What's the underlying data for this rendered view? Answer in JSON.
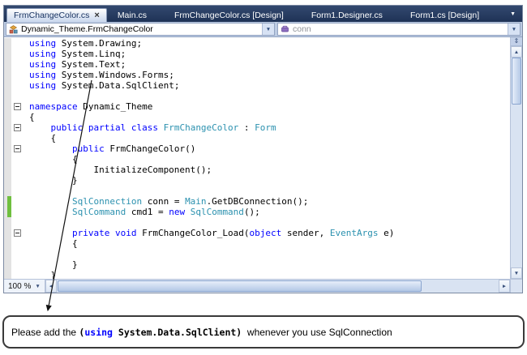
{
  "icons": {
    "close": "×",
    "dropdown": "▼",
    "up_arrow": "▲",
    "down_arrow": "▼",
    "left_arrow": "◄",
    "right_arrow": "►",
    "splitter": "⇕",
    "collapse_minus": "css-line-shape"
  },
  "window": {
    "tabs": [
      {
        "label": "FrmChangeColor.cs",
        "active": true
      },
      {
        "label": "Main.cs",
        "active": false
      },
      {
        "label": "FrmChangeColor.cs [Design]",
        "active": false
      },
      {
        "label": "Form1.Designer.cs",
        "active": false
      },
      {
        "label": "Form1.cs [Design]",
        "active": false
      }
    ],
    "navbar": {
      "type_selector": "Dynamic_Theme.FrmChangeColor",
      "member_selector": "conn"
    },
    "statusbar": {
      "zoom_level": "100 %"
    }
  },
  "code": {
    "lines": [
      {
        "tokens": [
          {
            "t": "using",
            "c": "kw"
          },
          {
            "t": " System.Drawing;",
            "c": "pl"
          }
        ]
      },
      {
        "tokens": [
          {
            "t": "using",
            "c": "kw"
          },
          {
            "t": " System.Linq;",
            "c": "pl"
          }
        ]
      },
      {
        "tokens": [
          {
            "t": "using",
            "c": "kw"
          },
          {
            "t": " System.Text;",
            "c": "pl"
          }
        ]
      },
      {
        "tokens": [
          {
            "t": "using",
            "c": "kw"
          },
          {
            "t": " System.Windows.Forms;",
            "c": "pl"
          }
        ]
      },
      {
        "tokens": [
          {
            "t": "using",
            "c": "kw"
          },
          {
            "t": " System.Data.SqlClient;",
            "c": "pl"
          }
        ]
      },
      {
        "tokens": []
      },
      {
        "fold": true,
        "tokens": [
          {
            "t": "namespace",
            "c": "kw"
          },
          {
            "t": " Dynamic_Theme",
            "c": "pl"
          }
        ]
      },
      {
        "tokens": [
          {
            "t": "{",
            "c": "pl"
          }
        ]
      },
      {
        "fold": true,
        "tokens": [
          {
            "t": "    ",
            "c": "pl"
          },
          {
            "t": "public partial class",
            "c": "kw"
          },
          {
            "t": " ",
            "c": "pl"
          },
          {
            "t": "FrmChangeColor",
            "c": "ty"
          },
          {
            "t": " : ",
            "c": "pl"
          },
          {
            "t": "Form",
            "c": "ty"
          }
        ]
      },
      {
        "tokens": [
          {
            "t": "    {",
            "c": "pl"
          }
        ]
      },
      {
        "fold": true,
        "tokens": [
          {
            "t": "        ",
            "c": "pl"
          },
          {
            "t": "public",
            "c": "kw"
          },
          {
            "t": " FrmChangeColor()",
            "c": "pl"
          }
        ]
      },
      {
        "tokens": [
          {
            "t": "        {",
            "c": "pl"
          }
        ]
      },
      {
        "tokens": [
          {
            "t": "            InitializeComponent();",
            "c": "pl"
          }
        ]
      },
      {
        "tokens": [
          {
            "t": "        }",
            "c": "pl"
          }
        ]
      },
      {
        "tokens": []
      },
      {
        "change": true,
        "tokens": [
          {
            "t": "        ",
            "c": "pl"
          },
          {
            "t": "SqlConnection",
            "c": "ty"
          },
          {
            "t": " conn = ",
            "c": "pl"
          },
          {
            "t": "Main",
            "c": "ty"
          },
          {
            "t": ".GetDBConnection();",
            "c": "pl"
          }
        ]
      },
      {
        "change": true,
        "tokens": [
          {
            "t": "        ",
            "c": "pl"
          },
          {
            "t": "SqlCommand",
            "c": "ty"
          },
          {
            "t": " cmd1 = ",
            "c": "pl"
          },
          {
            "t": "new",
            "c": "kw"
          },
          {
            "t": " ",
            "c": "pl"
          },
          {
            "t": "SqlCommand",
            "c": "ty"
          },
          {
            "t": "();",
            "c": "pl"
          }
        ]
      },
      {
        "tokens": []
      },
      {
        "fold": true,
        "tokens": [
          {
            "t": "        ",
            "c": "pl"
          },
          {
            "t": "private void",
            "c": "kw"
          },
          {
            "t": " FrmChangeColor_Load(",
            "c": "pl"
          },
          {
            "t": "object",
            "c": "kw"
          },
          {
            "t": " sender, ",
            "c": "pl"
          },
          {
            "t": "EventArgs",
            "c": "ty"
          },
          {
            "t": " e)",
            "c": "pl"
          }
        ]
      },
      {
        "tokens": [
          {
            "t": "        {",
            "c": "pl"
          }
        ]
      },
      {
        "tokens": []
      },
      {
        "tokens": [
          {
            "t": "        }",
            "c": "pl"
          }
        ]
      },
      {
        "tokens": [
          {
            "t": "    }",
            "c": "pl"
          }
        ]
      }
    ]
  },
  "callout": {
    "segments": [
      {
        "t": "Please add the ",
        "c": "plain"
      },
      {
        "t": "(",
        "c": "code"
      },
      {
        "t": "using",
        "c": "code-kw"
      },
      {
        "t": " System.Data.SqlClient",
        "c": "code"
      },
      {
        "t": ")",
        "c": "code"
      },
      {
        "t": "  whenever you use SqlConnection",
        "c": "plain"
      }
    ]
  },
  "colors": {
    "keyword": "#0000ff",
    "type_name": "#2b91af",
    "change_bar": "#6fbf3f",
    "tab_bar": "#243a60",
    "scrollbar_track": "#d9e3f2"
  }
}
